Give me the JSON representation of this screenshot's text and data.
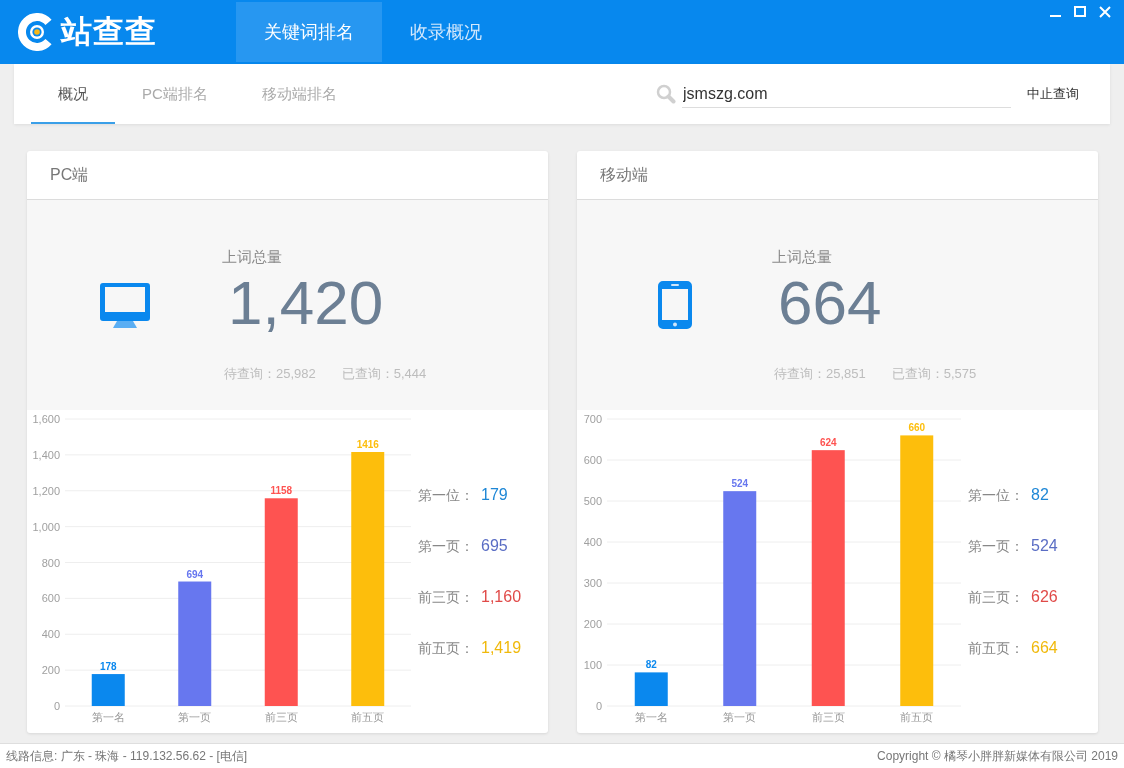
{
  "window": {
    "app_name": "站查查",
    "tabs": [
      {
        "label": "关键词排名",
        "selected": true
      },
      {
        "label": "收录概况",
        "selected": false
      }
    ]
  },
  "subnav": {
    "tabs": [
      {
        "label": "概况",
        "selected": true
      },
      {
        "label": "PC端排名",
        "selected": false
      },
      {
        "label": "移动端排名",
        "selected": false
      }
    ],
    "search": {
      "value": "jsmszg.com"
    },
    "stop_button": "中止查询"
  },
  "panels": [
    {
      "kind": "desktop",
      "title": "PC端",
      "total_label": "上词总量",
      "total": "1,420",
      "stats": [
        "待查询：25,982",
        "已查询：5,444"
      ],
      "chart_data": {
        "type": "bar",
        "categories": [
          "第一名",
          "第一页",
          "前三页",
          "前五页"
        ],
        "values": [
          178,
          694,
          1158,
          1416
        ],
        "colors": [
          "#0a88ee",
          "#6777ef",
          "#fe5351",
          "#fdbe0c"
        ],
        "ylim": [
          0,
          1600
        ],
        "yticks": [
          0,
          200,
          400,
          600,
          800,
          {
            "value": 1000,
            "label": "1,000"
          },
          {
            "value": 1200,
            "label": "1,200"
          },
          {
            "value": 1400,
            "label": "1,400"
          },
          {
            "value": 1600,
            "label": "1,600"
          }
        ],
        "grid": true,
        "data_labels": true
      },
      "summary": [
        {
          "label": "第一位：",
          "value": "179",
          "color": "#1e87d6"
        },
        {
          "label": "第一页：",
          "value": "695",
          "color": "#5a6dc4"
        },
        {
          "label": "前三页：",
          "value": "1,160",
          "color": "#e04a48"
        },
        {
          "label": "前五页：",
          "value": "1,419",
          "color": "#f0b90b"
        }
      ]
    },
    {
      "kind": "mobile",
      "title": "移动端",
      "total_label": "上词总量",
      "total": "664",
      "stats": [
        "待查询：25,851",
        "已查询：5,575"
      ],
      "chart_data": {
        "type": "bar",
        "categories": [
          "第一名",
          "第一页",
          "前三页",
          "前五页"
        ],
        "values": [
          82,
          524,
          624,
          660
        ],
        "colors": [
          "#0a88ee",
          "#6777ef",
          "#fe5351",
          "#fdbe0c"
        ],
        "ylim": [
          0,
          700
        ],
        "yticks": [
          0,
          100,
          200,
          300,
          400,
          500,
          600,
          700
        ],
        "grid": true,
        "data_labels": true
      },
      "summary": [
        {
          "label": "第一位：",
          "value": "82",
          "color": "#1e87d6"
        },
        {
          "label": "第一页：",
          "value": "524",
          "color": "#5a6dc4"
        },
        {
          "label": "前三页：",
          "value": "626",
          "color": "#e04a48"
        },
        {
          "label": "前五页：",
          "value": "664",
          "color": "#f0b90b"
        }
      ]
    }
  ],
  "status_bar": {
    "route": "线路信息: 广东 - 珠海 - 119.132.56.62 - [电信]",
    "copyright": "Copyright © 橘琴小胖胖新媒体有限公司 2019"
  }
}
